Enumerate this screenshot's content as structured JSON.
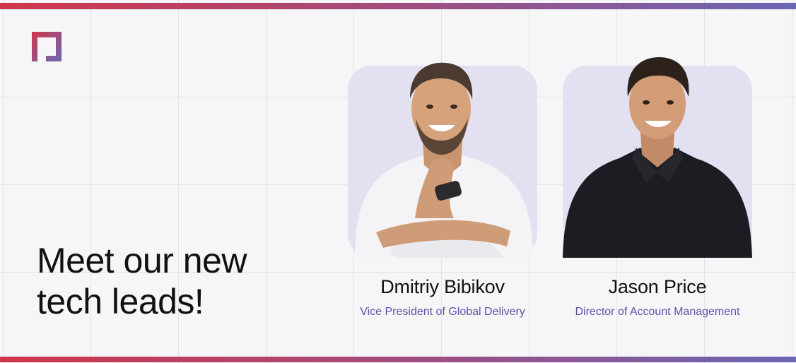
{
  "headline": {
    "line1": "Meet our new",
    "line2": "tech leads!"
  },
  "logo": {
    "icon": "brand-logo-icon",
    "colors": [
      "#d0364a",
      "#6b66b4"
    ]
  },
  "accent_bar_colors": [
    "#d0364a",
    "#a84a78",
    "#6b66b4"
  ],
  "people": [
    {
      "name": "Dmitriy Bibikov",
      "role": "Vice President of Global Delivery",
      "photo": "portrait-photo"
    },
    {
      "name": "Jason Price",
      "role": "Director of Account Management",
      "photo": "portrait-photo"
    }
  ],
  "colors": {
    "photo_background": "#e3e0f2",
    "role_text": "#5b54a6",
    "headline_text": "#111111"
  }
}
